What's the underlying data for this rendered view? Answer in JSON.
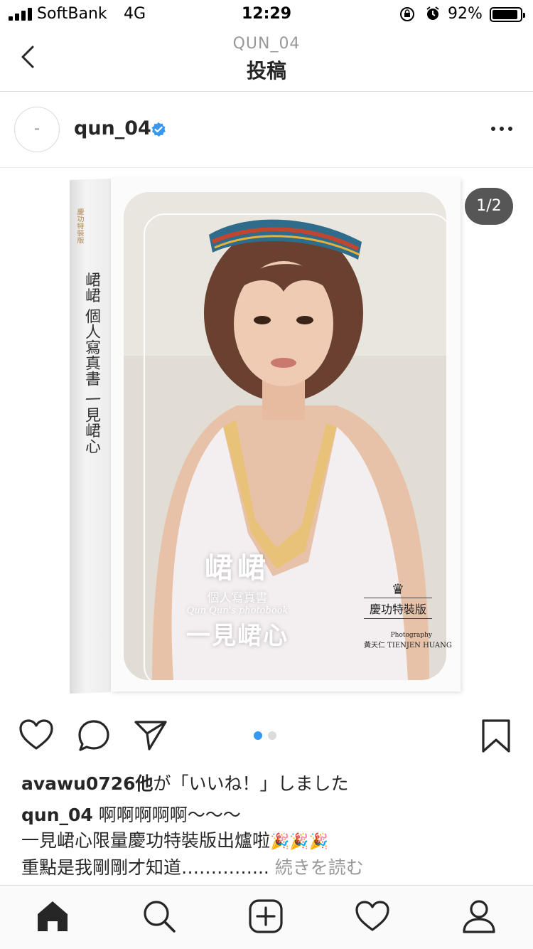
{
  "status_bar": {
    "carrier": "SoftBank",
    "network": "4G",
    "time": "12:29",
    "battery_percent": "92%",
    "battery_level": 0.92
  },
  "nav": {
    "subtitle": "QUN_04",
    "title": "投稿",
    "back_icon": "chevron-left-icon"
  },
  "post": {
    "username": "qun_04",
    "verified_icon": "verified-badge-icon",
    "more_icon": "more-options-icon",
    "page_counter": "1/2",
    "media": {
      "spine": {
        "badge": "慶功特裝版",
        "text": "峮峮 個人寫真書 一見峮心"
      },
      "cover": {
        "title": "峮峮",
        "line2": "個人寫真書",
        "line3": "Qun Qun's photobook",
        "line4": "一見峮心",
        "badge": "慶功特裝版",
        "photography_label": "Photography",
        "photographer": "黃天仁 TIENJEN HUANG"
      }
    },
    "carousel": {
      "count": 2,
      "active": 1
    },
    "likes": {
      "user": "avawu0726他",
      "suffix": "が「いいね！」しました"
    },
    "caption": {
      "username": "qun_04",
      "line1": "啊啊啊啊啊〜〜〜",
      "line2": "一見峮心限量慶功特裝版出爐啦",
      "emoji": "🎉🎉🎉",
      "line3": "重點是我剛剛才知道…………...",
      "more": "続きを読む"
    }
  },
  "tab_bar": {
    "items": [
      "home-icon",
      "search-icon",
      "new-post-icon",
      "activity-heart-icon",
      "profile-icon"
    ]
  }
}
